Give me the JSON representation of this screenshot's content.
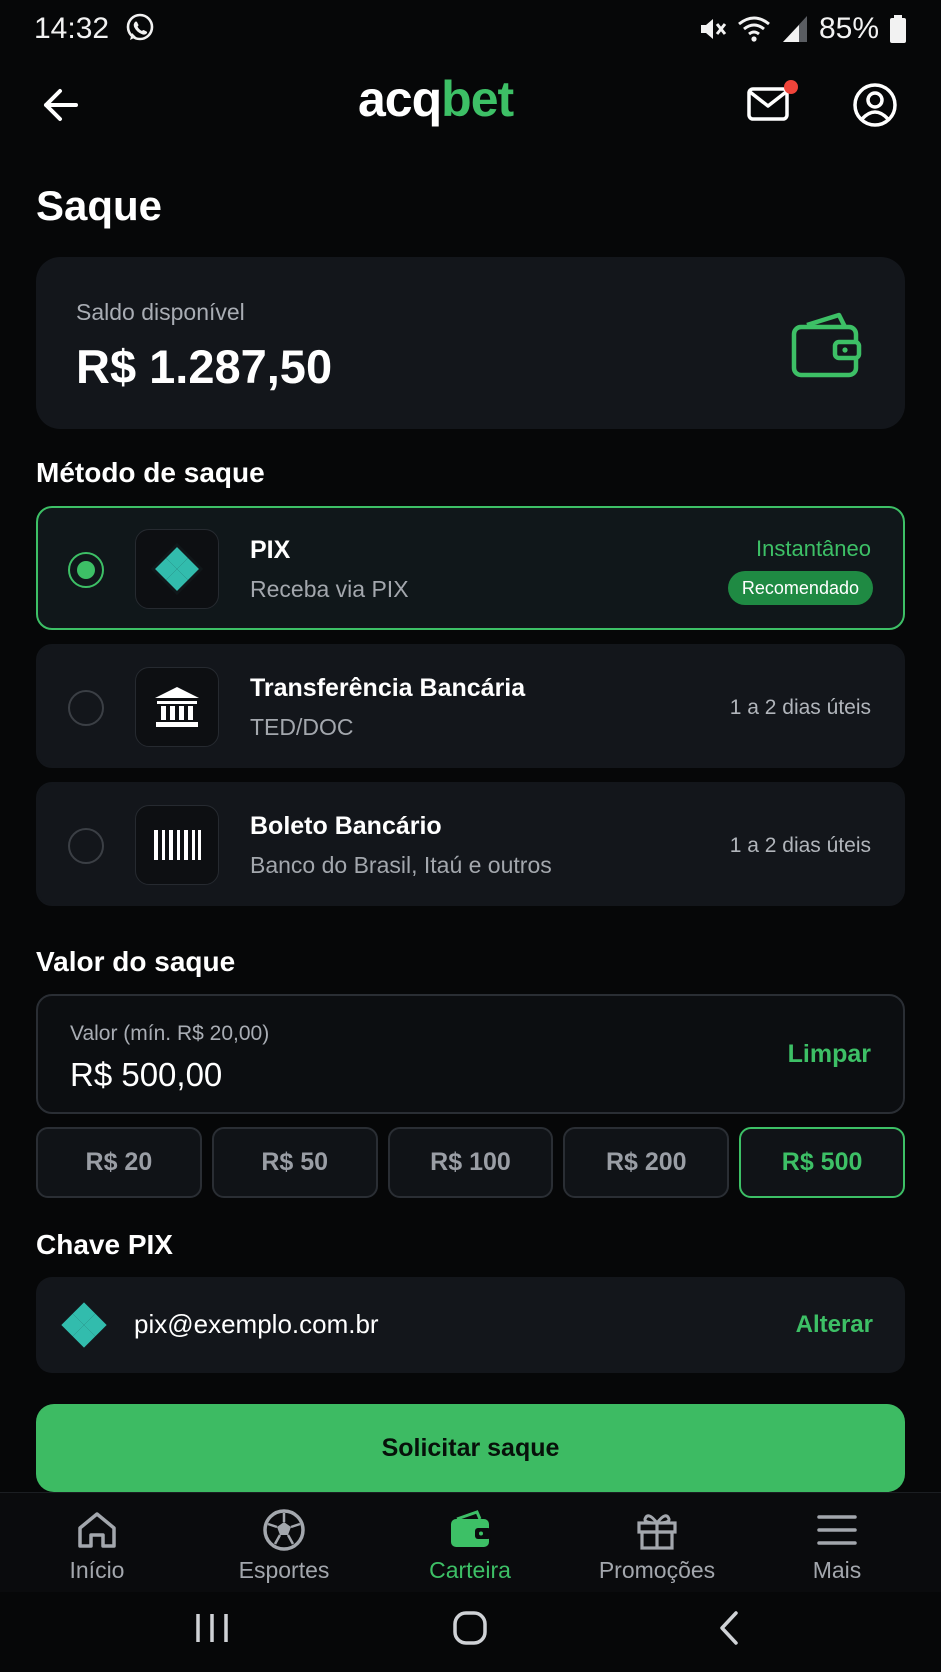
{
  "status_bar": {
    "time": "14:32",
    "battery": "85%"
  },
  "header": {
    "logo_prefix": "acq",
    "logo_suffix": "bet"
  },
  "page_title": "Saque",
  "balance": {
    "label": "Saldo disponível",
    "value": "R$ 1.287,50"
  },
  "methods_title": "Método de saque",
  "methods": [
    {
      "name": "PIX",
      "subtitle": "Receba via PIX",
      "time": "Instantâneo",
      "badge": "Recomendado",
      "selected": true
    },
    {
      "name": "Transferência Bancária",
      "subtitle": "TED/DOC",
      "time": "1 a 2 dias úteis",
      "selected": false
    },
    {
      "name": "Boleto Bancário",
      "subtitle": "Banco do Brasil, Itaú e outros",
      "time": "1 a 2 dias úteis",
      "selected": false
    }
  ],
  "amount_title": "Valor do saque",
  "amount": {
    "label": "Valor (mín. R$ 20,00)",
    "value": "R$ 500,00",
    "clear_label": "Limpar"
  },
  "quick_amounts": [
    "R$ 20",
    "R$ 50",
    "R$ 100",
    "R$ 200",
    "R$ 500"
  ],
  "quick_amount_selected": "R$ 500",
  "pix_key_title": "Chave PIX",
  "pix_key": {
    "value": "pix@exemplo.com.br",
    "change_label": "Alterar"
  },
  "submit_label": "Solicitar saque",
  "bottom_nav": [
    {
      "label": "Início",
      "icon": "home-icon",
      "active": false
    },
    {
      "label": "Esportes",
      "icon": "soccer-ball-icon",
      "active": false
    },
    {
      "label": "Carteira",
      "icon": "wallet-icon",
      "active": true
    },
    {
      "label": "Promoções",
      "icon": "gift-icon",
      "active": false
    },
    {
      "label": "Mais",
      "icon": "menu-icon",
      "active": false
    }
  ],
  "colors": {
    "accent": "#3dc066",
    "background": "#060708",
    "card": "#13161b",
    "notification": "#f0443a"
  }
}
